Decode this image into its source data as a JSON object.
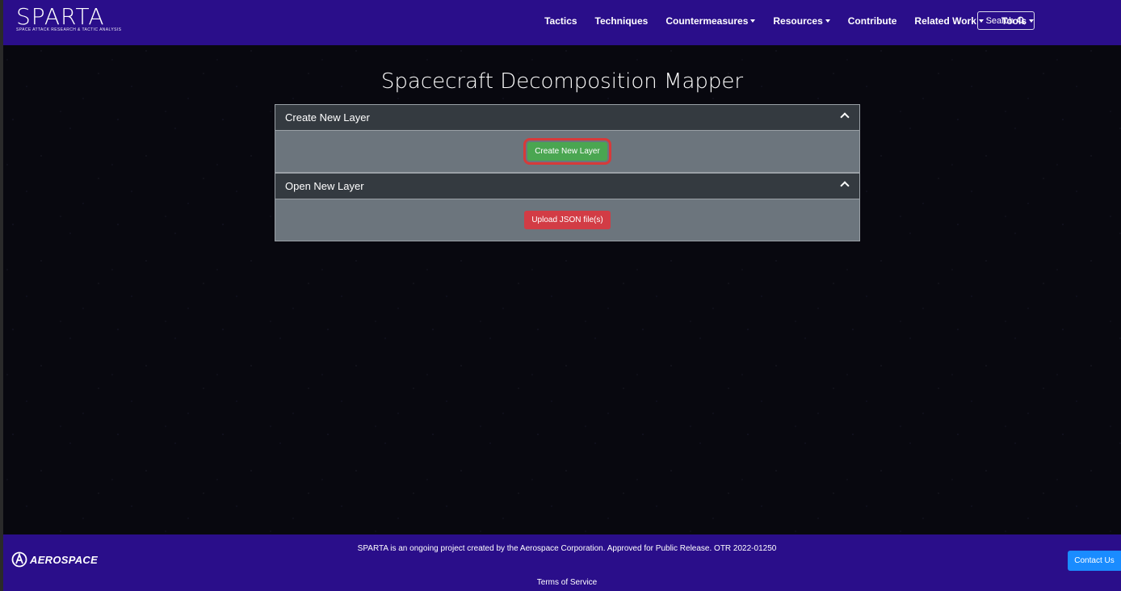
{
  "header": {
    "brand": "SPARTA",
    "brand_tagline": "SPACE ATTACK RESEARCH & TACTIC ANALYSIS",
    "nav": [
      {
        "label": "Tactics",
        "dropdown": false
      },
      {
        "label": "Techniques",
        "dropdown": false
      },
      {
        "label": "Countermeasures",
        "dropdown": true
      },
      {
        "label": "Resources",
        "dropdown": true
      },
      {
        "label": "Contribute",
        "dropdown": false
      },
      {
        "label": "Related Work",
        "dropdown": true
      },
      {
        "label": "Tools",
        "dropdown": true
      }
    ],
    "search_label": "Search"
  },
  "main": {
    "title": "Spacecraft Decomposition Mapper",
    "panels": [
      {
        "header": "Create New Layer",
        "button": "Create New Layer"
      },
      {
        "header": "Open New Layer",
        "button": "Upload JSON file(s)"
      }
    ]
  },
  "footer": {
    "logo_text": "AEROSPACE",
    "notice": "SPARTA is an ongoing project created by the Aerospace Corporation. Approved for Public Release. OTR 2022-01250",
    "terms": "Terms of Service",
    "contact": "Contact Us"
  },
  "colors": {
    "header_bg": "#2a0e8a",
    "panel_header_bg": "#343a40",
    "panel_body_bg": "#6c757d",
    "create_button": "#4aa651",
    "upload_button": "#d23c45",
    "highlight_outline": "#d73a3a",
    "contact_button": "#1a8cff"
  }
}
